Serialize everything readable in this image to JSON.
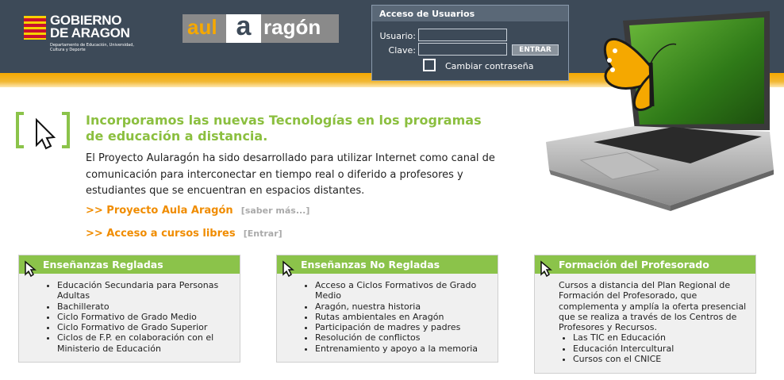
{
  "gobierno": {
    "title_line1": "GOBIERNO",
    "title_line2": "DE ARAGON",
    "subtitle": "Departamento de Educación, Universidad, Cultura y Deporte"
  },
  "aula_logo": {
    "part1": "aul",
    "part2": "a",
    "part3": "ragón"
  },
  "login": {
    "title": "Acceso de Usuarios",
    "user_label": "Usuario:",
    "pass_label": "Clave:",
    "user_value": "",
    "pass_value": "",
    "submit_label": "ENTRAR",
    "change_password_label": "Cambiar contraseña"
  },
  "intro": {
    "title": "Incorporamos las nuevas Tecnologías en los programas de educación a distancia.",
    "text": "El Proyecto Aularagón ha sido desarrollado para utilizar Internet como canal de comunicación para interconectar en tiempo real o diferido a profesores y estudiantes que se encuentran en espacios distantes.",
    "links": [
      {
        "label": ">> Proyecto Aula Aragón",
        "sub": "[saber más...]"
      },
      {
        "label": ">> Acceso a cursos libres",
        "sub": "[Entrar]"
      }
    ]
  },
  "boxes": [
    {
      "title": "Enseñanzas Regladas",
      "items": [
        "Educación Secundaria para Personas Adultas",
        "Bachillerato",
        "Ciclo Formativo de Grado Medio",
        "Ciclo Formativo de Grado Superior",
        "Ciclos de F.P. en colaboración con el Ministerio de Educación"
      ]
    },
    {
      "title": "Enseñanzas No Regladas",
      "items": [
        "Acceso a Ciclos Formativos de Grado Medio",
        "Aragón, nuestra historia",
        "Rutas ambientales en Aragón",
        "Participación de madres y padres",
        "Resolución de conflictos",
        "Entrenamiento y apoyo a la memoria"
      ]
    },
    {
      "title": "Formación del Profesorado",
      "text": "Cursos a distancia del Plan Regional de Formación del Profesorado, que complementa y amplía la oferta presencial que se realiza a través de los Centros de Profesores y Recursos.",
      "items": [
        "Las TIC en Educación",
        "Educación Intercultural",
        "Cursos con el CNICE"
      ]
    }
  ],
  "colors": {
    "header": "#3d4a58",
    "accent_green": "#8bc34a",
    "title_green": "#8bbf3f",
    "link_orange": "#f08c00",
    "band_orange": "#f6a800"
  }
}
